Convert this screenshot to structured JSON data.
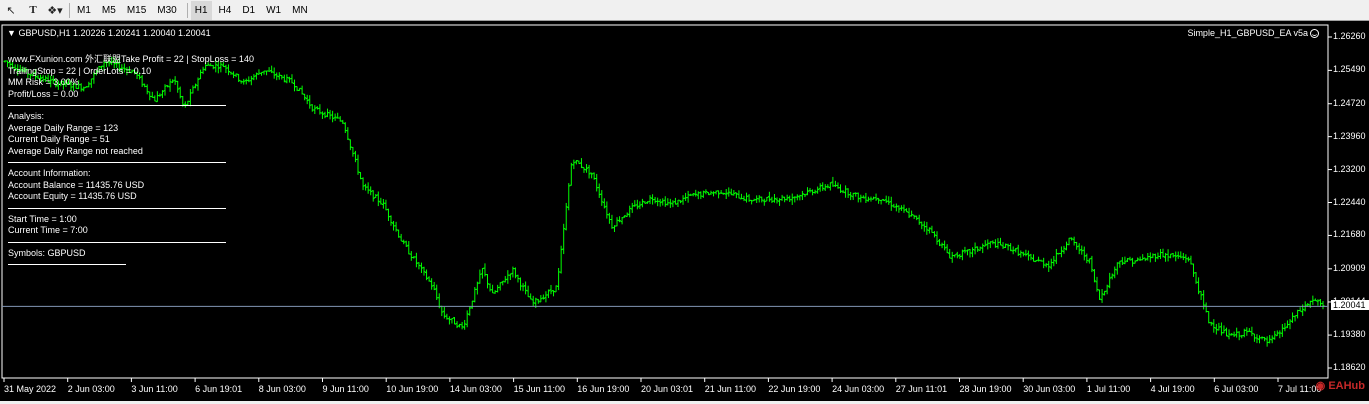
{
  "toolbar": {
    "icons": [
      "cursor-icon",
      "text-tool-icon",
      "shapes-dropdown-icon"
    ],
    "timeframes": [
      "M1",
      "M5",
      "M15",
      "M30",
      "H1",
      "H4",
      "D1",
      "W1",
      "MN"
    ],
    "active": "H1"
  },
  "chart": {
    "header": "GBPUSD,H1  1.20226 1.20241 1.20040 1.20041",
    "ea_name": "Simple_H1_GBPUSD_EA v5a",
    "current_price": "1.20041",
    "price_labels": [
      "1.26260",
      "1.25490",
      "1.24720",
      "1.23960",
      "1.23200",
      "1.22440",
      "1.21680",
      "1.20909",
      "1.20144",
      "1.19380",
      "1.18620"
    ],
    "time_labels": [
      "31 May 2022",
      "2 Jun 03:00",
      "3 Jun 11:00",
      "6 Jun 19:01",
      "8 Jun 03:00",
      "9 Jun 11:00",
      "10 Jun 19:00",
      "14 Jun 03:00",
      "15 Jun 11:00",
      "16 Jun 19:00",
      "20 Jun 03:01",
      "21 Jun 11:00",
      "22 Jun 19:00",
      "24 Jun 03:00",
      "27 Jun 11:01",
      "28 Jun 19:00",
      "30 Jun 03:00",
      "1 Jul 11:00",
      "4 Jul 19:00",
      "6 Jul 03:00",
      "7 Jul 11:00"
    ],
    "colors": {
      "background": "#000000",
      "bars": "#00ff00",
      "text": "#ffffff",
      "bid_line": "#8296b4"
    }
  },
  "info_panel": {
    "lines": [
      "www.FXunion.com 外汇联盟Take Profit = 22 | StopLoss = 140",
      "TrailingStop = 22 | OrderLots = 0.10",
      "MM Risk = 3.00%",
      "Profit/Loss = 0.00"
    ],
    "analysis": [
      "Analysis:",
      "Average Daily Range  = 123",
      "Current Daily Range  = 51",
      "Average Daily Range not reached"
    ],
    "account": [
      "Account Information:",
      "Account Balance = 11435.76 USD",
      "Account Equity  = 11435.76 USD"
    ],
    "time": [
      "Start Time = 1:00",
      "Current Time = 7:00"
    ],
    "symbols": "Symbols: GBPUSD"
  },
  "watermark": {
    "icon": "eahub-logo-icon",
    "text": "EAHub"
  },
  "chart_data": {
    "type": "bar",
    "symbol": "GBPUSD",
    "timeframe": "H1",
    "ohlc_last": {
      "open": 1.20226,
      "high": 1.20241,
      "low": 1.2004,
      "close": 1.20041
    },
    "ylim": [
      1.1862,
      1.2626
    ],
    "anchors": [
      [
        0,
        1.257
      ],
      [
        0.02,
        1.2545
      ],
      [
        0.05,
        1.252
      ],
      [
        0.08,
        1.251
      ],
      [
        0.1,
        1.257
      ],
      [
        0.13,
        1.2545
      ],
      [
        0.15,
        1.248
      ],
      [
        0.17,
        1.253
      ],
      [
        0.18,
        1.246
      ],
      [
        0.2,
        1.256
      ],
      [
        0.22,
        1.256
      ],
      [
        0.24,
        1.252
      ],
      [
        0.26,
        1.255
      ],
      [
        0.29,
        1.252
      ],
      [
        0.31,
        1.246
      ],
      [
        0.34,
        1.243
      ],
      [
        0.36,
        1.228
      ],
      [
        0.38,
        1.224
      ],
      [
        0.4,
        1.215
      ],
      [
        0.43,
        1.205
      ],
      [
        0.44,
        1.1985
      ],
      [
        0.46,
        1.1955
      ],
      [
        0.48,
        1.209
      ],
      [
        0.49,
        1.203
      ],
      [
        0.51,
        1.209
      ],
      [
        0.53,
        1.201
      ],
      [
        0.555,
        1.205
      ],
      [
        0.57,
        1.2345
      ],
      [
        0.59,
        1.231
      ],
      [
        0.61,
        1.219
      ],
      [
        0.63,
        1.223
      ],
      [
        0.65,
        1.2255
      ],
      [
        0.67,
        1.224
      ],
      [
        0.69,
        1.226
      ],
      [
        0.72,
        1.227
      ],
      [
        0.75,
        1.225
      ],
      [
        0.79,
        1.2255
      ],
      [
        0.83,
        1.2285
      ],
      [
        0.86,
        1.2255
      ],
      [
        0.88,
        1.2255
      ],
      [
        0.91,
        1.2215
      ],
      [
        0.93,
        1.218
      ],
      [
        0.95,
        1.212
      ],
      [
        0.97,
        1.213
      ],
      [
        0.99,
        1.215
      ],
      [
        1.01,
        1.214
      ],
      [
        1.03,
        1.2115
      ],
      [
        1.05,
        1.21
      ],
      [
        1.07,
        1.216
      ],
      [
        1.09,
        1.211
      ],
      [
        1.1,
        1.202
      ],
      [
        1.12,
        1.211
      ],
      [
        1.14,
        1.211
      ],
      [
        1.16,
        1.2125
      ],
      [
        1.19,
        1.2115
      ],
      [
        1.21,
        1.197
      ],
      [
        1.23,
        1.1935
      ],
      [
        1.25,
        1.1945
      ],
      [
        1.27,
        1.192
      ],
      [
        1.28,
        1.194
      ],
      [
        1.3,
        1.199
      ],
      [
        1.315,
        1.202
      ],
      [
        1.325,
        1.2004
      ]
    ],
    "x_domain": [
      0,
      1.325
    ]
  }
}
